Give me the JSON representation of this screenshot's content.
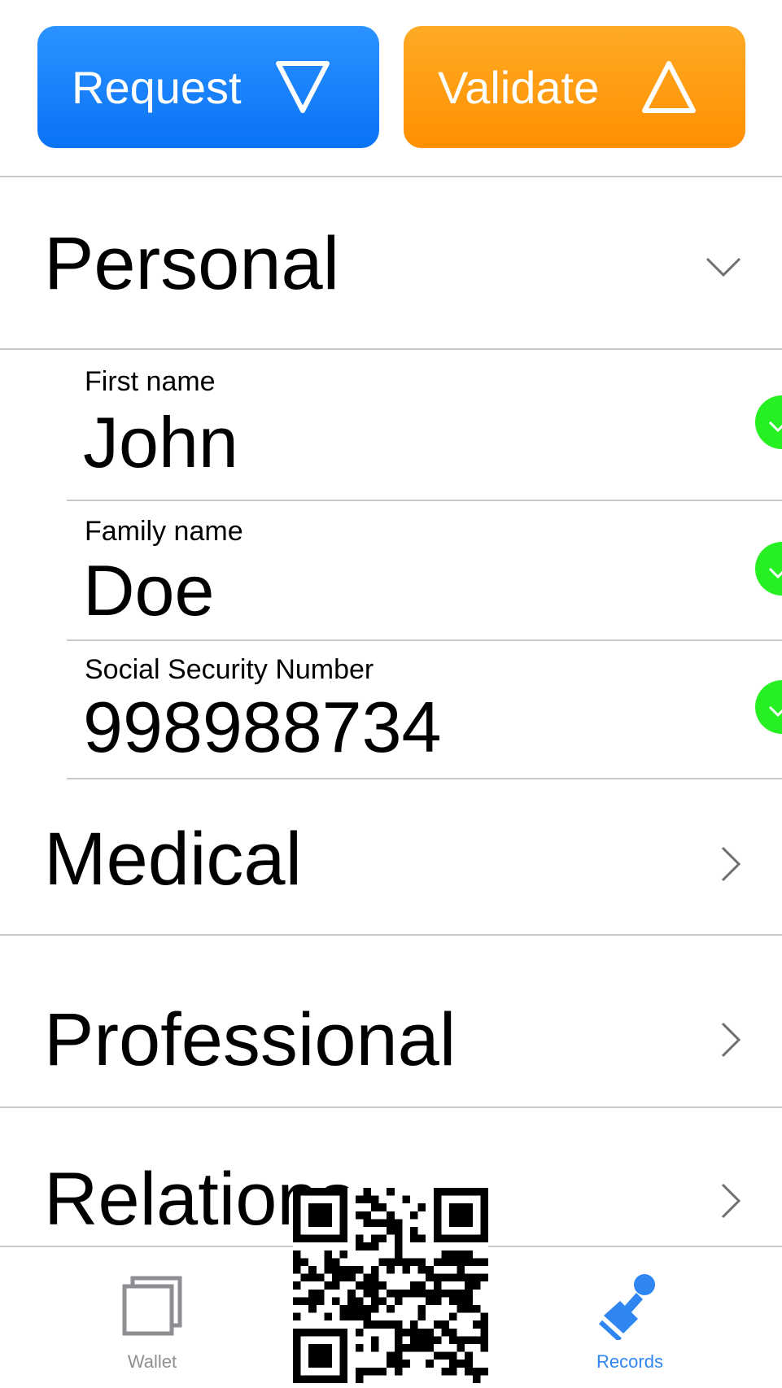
{
  "toolbar": {
    "request_label": "Request",
    "validate_label": "Validate",
    "request_color": "#1582ff",
    "validate_color": "#ff9d14"
  },
  "sections": {
    "personal": {
      "title": "Personal",
      "expanded": true,
      "fields": [
        {
          "label": "First name",
          "value": "John",
          "verified": true
        },
        {
          "label": "Family name",
          "value": "Doe",
          "verified": true
        },
        {
          "label": "Social Security Number",
          "value": "998988734",
          "verified": true
        }
      ]
    },
    "medical": {
      "title": "Medical"
    },
    "professional": {
      "title": "Professional"
    },
    "relations": {
      "title": "Relations"
    }
  },
  "tabbar": {
    "tabs": [
      {
        "label": "Wallet",
        "icon": "stacked-squares-icon",
        "active": false
      },
      {
        "label": "Records",
        "icon": "stamp-icon",
        "active": true
      }
    ],
    "active_color": "#2f86f0",
    "inactive_color": "#8e8e93"
  },
  "qr_icon": "qr-code-icon"
}
